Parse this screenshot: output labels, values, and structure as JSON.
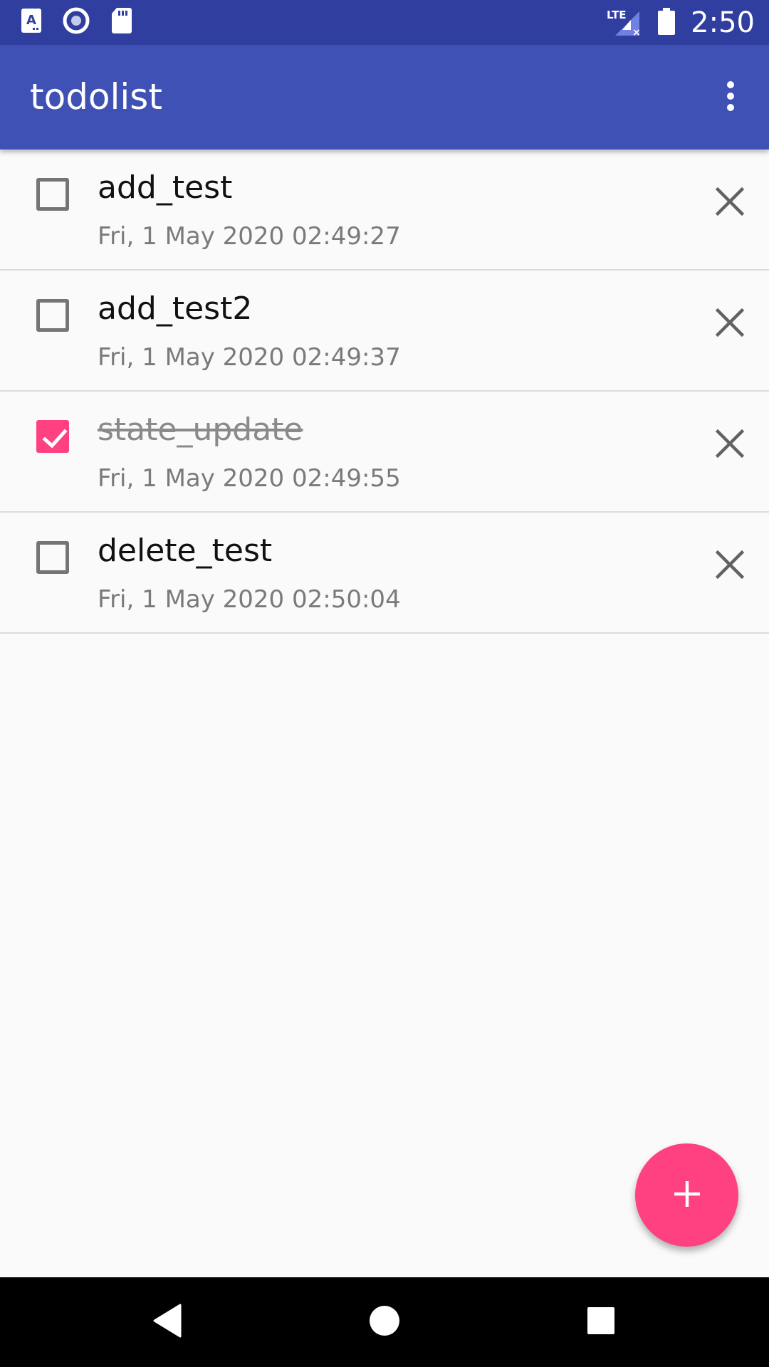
{
  "status_bar": {
    "time": "2:50",
    "network_label": "LTE",
    "icons": [
      "text-a-icon",
      "sync-circle-icon",
      "sd-card-icon",
      "signal-icon",
      "battery-icon"
    ]
  },
  "app_bar": {
    "title": "todolist",
    "menu_icon": "overflow-menu-icon"
  },
  "todos": [
    {
      "title": "add_test",
      "timestamp": "Fri, 1 May 2020 02:49:27",
      "checked": false
    },
    {
      "title": "add_test2",
      "timestamp": "Fri, 1 May 2020 02:49:37",
      "checked": false
    },
    {
      "title": "state_update",
      "timestamp": "Fri, 1 May 2020 02:49:55",
      "checked": true
    },
    {
      "title": "delete_test",
      "timestamp": "Fri, 1 May 2020 02:50:04",
      "checked": false
    }
  ],
  "fab": {
    "icon": "plus-icon"
  },
  "nav_bar": {
    "icons": [
      "back-icon",
      "home-icon",
      "recents-icon"
    ]
  },
  "colors": {
    "primary": "#3f51b5",
    "primary_dark": "#303f9f",
    "accent": "#ff4081"
  }
}
